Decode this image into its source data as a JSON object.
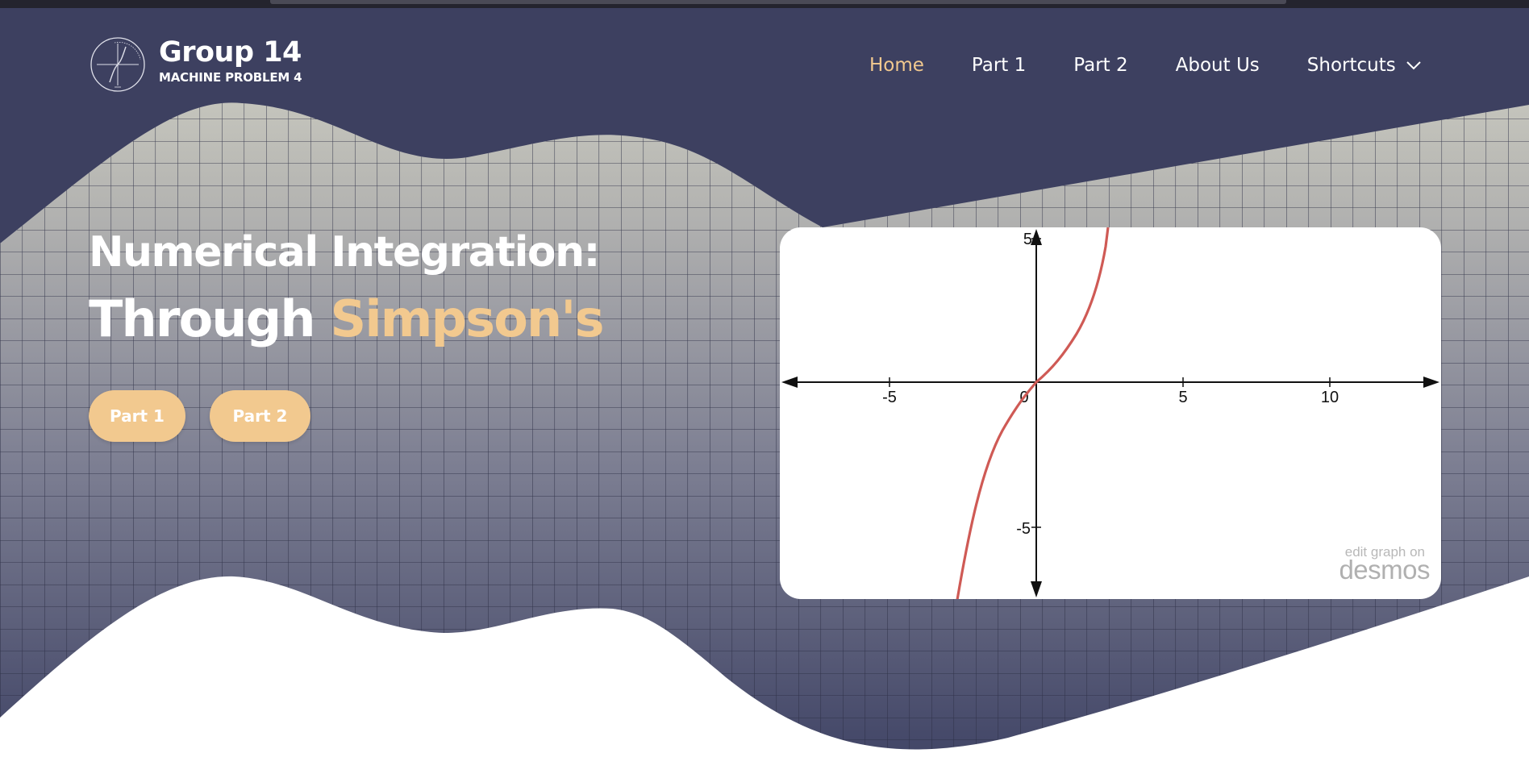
{
  "header": {
    "brand_title": "Group 14",
    "brand_subtitle": "MACHINE PROBLEM 4",
    "logo_icon": "hyperbolic-function-logo-icon"
  },
  "nav": {
    "items": [
      {
        "label": "Home",
        "active": true
      },
      {
        "label": "Part 1",
        "active": false
      },
      {
        "label": "Part 2",
        "active": false
      },
      {
        "label": "About Us",
        "active": false
      }
    ],
    "shortcuts_label": "Shortcuts",
    "shortcuts_icon": "chevron-down-icon"
  },
  "hero": {
    "title_line1": "Numerical Integration:",
    "title_line2_prefix": "Through",
    "title_line2_accent": "Simpson's",
    "buttons": [
      {
        "label": "Part 1"
      },
      {
        "label": "Part 2"
      }
    ]
  },
  "graph": {
    "x_ticks": [
      "-5",
      "0",
      "5",
      "10"
    ],
    "y_ticks": [
      "5",
      "-5"
    ],
    "watermark_small": "edit graph on",
    "watermark_brand": "desmos"
  },
  "colors": {
    "navy": "#3d4060",
    "accent": "#f2c98f",
    "curve": "#cf5a55"
  }
}
